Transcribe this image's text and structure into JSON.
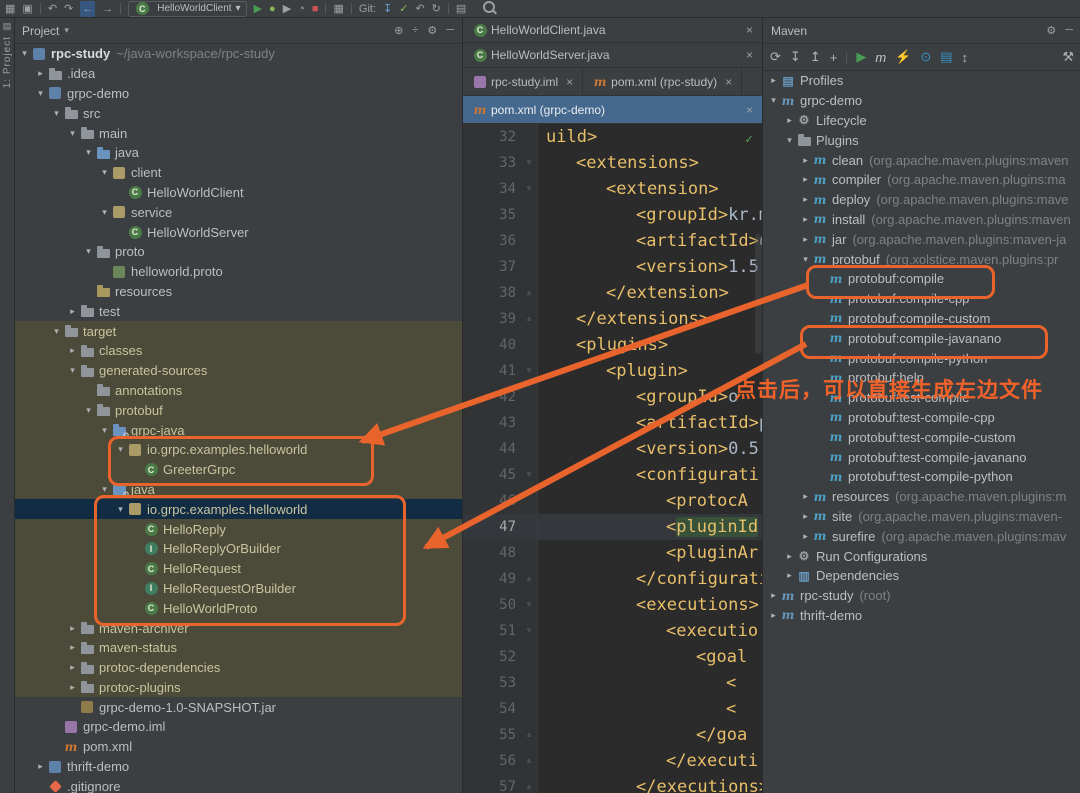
{
  "stripe": {
    "project_label": "1: Project"
  },
  "toolbar": {
    "items": [
      {
        "type": "icon",
        "name": "window-menu-icon",
        "glyph": "▦"
      },
      {
        "type": "icon",
        "name": "open-recent-icon",
        "glyph": "▣"
      },
      {
        "type": "sep"
      },
      {
        "type": "icon",
        "name": "undo-icon",
        "glyph": "↶"
      },
      {
        "type": "icon",
        "name": "redo-icon",
        "glyph": "↷"
      },
      {
        "type": "icon",
        "name": "back-icon",
        "glyph": "←",
        "active": true
      },
      {
        "type": "icon",
        "name": "forward-icon",
        "glyph": "→"
      },
      {
        "type": "sep"
      },
      {
        "type": "dropdown",
        "name": "run-configuration-select",
        "label": "HelloWorldClient"
      },
      {
        "type": "icon",
        "name": "run-icon",
        "glyph": "▶",
        "color": "#499c54"
      },
      {
        "type": "icon",
        "name": "debug-icon",
        "glyph": "●",
        "color": "#89b859"
      },
      {
        "type": "icon",
        "name": "run-coverage-icon",
        "glyph": "▶",
        "color": "#9da0a3"
      },
      {
        "type": "icon",
        "name": "profiler-icon",
        "glyph": "◔",
        "color": "#9da0a3"
      },
      {
        "type": "icon",
        "name": "stop-icon",
        "glyph": "■",
        "color": "#c75450"
      },
      {
        "type": "sep"
      },
      {
        "type": "icon",
        "name": "layout-grid-icon",
        "glyph": "▦",
        "color": "#9da0a3"
      },
      {
        "type": "sep"
      },
      {
        "type": "label",
        "name": "git-label",
        "text": "Git:"
      },
      {
        "type": "icon",
        "name": "git-update-icon",
        "glyph": "↧",
        "color": "#6a9fd8"
      },
      {
        "type": "icon",
        "name": "git-commit-icon",
        "glyph": "✓",
        "color": "#89b859"
      },
      {
        "type": "icon",
        "name": "git-rollback-icon",
        "glyph": "↶",
        "color": "#9da0a3"
      },
      {
        "type": "icon",
        "name": "git-history-icon",
        "glyph": "↻",
        "color": "#9da0a3"
      },
      {
        "type": "sep"
      },
      {
        "type": "icon",
        "name": "diff-icon",
        "glyph": "▤",
        "color": "#9da0a3"
      },
      {
        "type": "search",
        "name": "search-everywhere-icon"
      }
    ]
  },
  "project_panel": {
    "title": "Project",
    "tree": [
      {
        "label": "rpc-study",
        "hint": "~/java-workspace/rpc-study",
        "level": 0,
        "icon": "project-icon",
        "arrow": "open",
        "bold": true
      },
      {
        "label": ".idea",
        "level": 1,
        "icon": "folder-icon",
        "arrow": "closed"
      },
      {
        "label": "grpc-demo",
        "level": 1,
        "icon": "module-icon",
        "arrow": "open"
      },
      {
        "label": "src",
        "level": 2,
        "icon": "folder-icon",
        "arrow": "open"
      },
      {
        "label": "main",
        "level": 3,
        "icon": "folder-icon",
        "arrow": "open"
      },
      {
        "label": "java",
        "level": 4,
        "icon": "src-folder-icon",
        "arrow": "open"
      },
      {
        "label": "client",
        "level": 5,
        "icon": "package-icon",
        "arrow": "open"
      },
      {
        "label": "HelloWorldClient",
        "level": 6,
        "icon": "class-icon"
      },
      {
        "label": "service",
        "level": 5,
        "icon": "package-icon",
        "arrow": "open"
      },
      {
        "label": "HelloWorldServer",
        "level": 6,
        "icon": "class-icon"
      },
      {
        "label": "proto",
        "level": 4,
        "icon": "folder-icon",
        "arrow": "open"
      },
      {
        "label": "helloworld.proto",
        "level": 5,
        "icon": "proto-file-icon"
      },
      {
        "label": "resources",
        "level": 4,
        "icon": "res-folder-icon"
      },
      {
        "label": "test",
        "level": 3,
        "icon": "folder-icon",
        "arrow": "closed"
      },
      {
        "label": "target",
        "level": 2,
        "icon": "folder-icon",
        "arrow": "open",
        "scope": "excluded"
      },
      {
        "label": "classes",
        "level": 3,
        "icon": "folder-icon",
        "arrow": "closed",
        "scope": "excluded"
      },
      {
        "label": "generated-sources",
        "level": 3,
        "icon": "folder-icon",
        "arrow": "open",
        "scope": "excluded"
      },
      {
        "label": "annotations",
        "level": 4,
        "icon": "folder-icon",
        "scope": "excluded"
      },
      {
        "label": "protobuf",
        "level": 4,
        "icon": "folder-icon",
        "arrow": "open",
        "scope": "excluded"
      },
      {
        "label": "grpc-java",
        "level": 5,
        "icon": "gen-folder-icon",
        "arrow": "open",
        "scope": "excluded"
      },
      {
        "label": "io.grpc.examples.helloworld",
        "level": 6,
        "icon": "package-icon",
        "arrow": "open",
        "scope": "excluded"
      },
      {
        "label": "GreeterGrpc",
        "level": 7,
        "icon": "class-icon",
        "scope": "excluded"
      },
      {
        "label": "java",
        "level": 5,
        "icon": "gen-folder-icon",
        "arrow": "open",
        "scope": "excluded"
      },
      {
        "label": "io.grpc.examples.helloworld",
        "level": 6,
        "icon": "package-icon",
        "arrow": "open",
        "selected": true,
        "scope": "excluded"
      },
      {
        "label": "HelloReply",
        "level": 7,
        "icon": "class-icon",
        "scope": "excluded"
      },
      {
        "label": "HelloReplyOrBuilder",
        "level": 7,
        "icon": "interface-icon",
        "scope": "excluded"
      },
      {
        "label": "HelloRequest",
        "level": 7,
        "icon": "class-icon",
        "scope": "excluded"
      },
      {
        "label": "HelloRequestOrBuilder",
        "level": 7,
        "icon": "interface-icon",
        "scope": "excluded"
      },
      {
        "label": "HelloWorldProto",
        "level": 7,
        "icon": "class-icon",
        "scope": "excluded"
      },
      {
        "label": "maven-archiver",
        "level": 3,
        "icon": "folder-icon",
        "arrow": "closed",
        "scope": "excluded"
      },
      {
        "label": "maven-status",
        "level": 3,
        "icon": "folder-icon",
        "arrow": "closed",
        "scope": "excluded"
      },
      {
        "label": "protoc-dependencies",
        "level": 3,
        "icon": "folder-icon",
        "arrow": "closed",
        "scope": "excluded"
      },
      {
        "label": "protoc-plugins",
        "level": 3,
        "icon": "folder-icon",
        "arrow": "closed",
        "scope": "excluded"
      },
      {
        "label": "grpc-demo-1.0-SNAPSHOT.jar",
        "level": 3,
        "icon": "jar-icon"
      },
      {
        "label": "grpc-demo.iml",
        "level": 2,
        "icon": "iml-file-icon"
      },
      {
        "label": "pom.xml",
        "level": 2,
        "icon": "maven-file-icon"
      },
      {
        "label": "thrift-demo",
        "level": 1,
        "icon": "module-icon",
        "arrow": "closed"
      },
      {
        "label": ".gitignore",
        "level": 1,
        "icon": "gitignore-icon"
      }
    ]
  },
  "editor": {
    "tab_rows": [
      [
        {
          "label": "HelloWorldClient.java",
          "icon": "class-icon",
          "close": true
        }
      ],
      [
        {
          "label": "HelloWorldServer.java",
          "icon": "class-icon",
          "close": true
        }
      ],
      [
        {
          "label": "rpc-study.iml",
          "icon": "iml-file-icon",
          "close": true
        },
        {
          "label": "pom.xml (rpc-study)",
          "icon": "maven-file-icon",
          "close": true
        }
      ],
      [
        {
          "label": "pom.xml (grpc-demo)",
          "icon": "maven-file-icon",
          "close": true,
          "active": true
        }
      ]
    ],
    "lines": [
      {
        "num": 32,
        "indent": 0,
        "parts": [
          {
            "t": "uild>",
            "c": "tag"
          }
        ]
      },
      {
        "num": 33,
        "indent": 1,
        "parts": [
          {
            "t": "<extensions>",
            "c": "tag"
          }
        ],
        "fold": "open"
      },
      {
        "num": 34,
        "indent": 2,
        "parts": [
          {
            "t": "<extension>",
            "c": "tag"
          }
        ],
        "fold": "open"
      },
      {
        "num": 35,
        "indent": 3,
        "parts": [
          {
            "t": "<groupId>",
            "c": "tag"
          },
          {
            "t": "kr.m",
            "c": "text"
          }
        ]
      },
      {
        "num": 36,
        "indent": 3,
        "parts": [
          {
            "t": "<artifactId>",
            "c": "tag"
          },
          {
            "t": "o",
            "c": "text"
          }
        ]
      },
      {
        "num": 37,
        "indent": 3,
        "parts": [
          {
            "t": "<version>",
            "c": "tag"
          },
          {
            "t": "1.5.",
            "c": "text"
          }
        ]
      },
      {
        "num": 38,
        "indent": 2,
        "parts": [
          {
            "t": "</extension>",
            "c": "tag"
          }
        ],
        "fold": "close"
      },
      {
        "num": 39,
        "indent": 1,
        "parts": [
          {
            "t": "</extensions>",
            "c": "tag"
          }
        ],
        "fold": "close"
      },
      {
        "num": 40,
        "indent": 1,
        "parts": [
          {
            "t": "<plugins>",
            "c": "tag"
          }
        ]
      },
      {
        "num": 41,
        "indent": 2,
        "parts": [
          {
            "t": "<plugin>",
            "c": "tag"
          }
        ],
        "fold": "open"
      },
      {
        "num": 42,
        "indent": 3,
        "parts": [
          {
            "t": "<groupId>",
            "c": "tag"
          },
          {
            "t": "o",
            "c": "text"
          }
        ]
      },
      {
        "num": 43,
        "indent": 3,
        "parts": [
          {
            "t": "<artifactId>",
            "c": "tag"
          },
          {
            "t": "p",
            "c": "text"
          }
        ]
      },
      {
        "num": 44,
        "indent": 3,
        "parts": [
          {
            "t": "<version>",
            "c": "tag"
          },
          {
            "t": "0.5.",
            "c": "text"
          }
        ]
      },
      {
        "num": 45,
        "indent": 3,
        "parts": [
          {
            "t": "<configurati",
            "c": "tag"
          }
        ],
        "fold": "open"
      },
      {
        "num": 46,
        "indent": 4,
        "parts": [
          {
            "t": "<protocA",
            "c": "tag"
          }
        ]
      },
      {
        "num": 47,
        "indent": 4,
        "parts": [
          {
            "t": "<",
            "c": "tag"
          },
          {
            "t": "pluginId",
            "c": "tag",
            "hl": true
          }
        ],
        "current": true
      },
      {
        "num": 48,
        "indent": 4,
        "parts": [
          {
            "t": "<pluginAr",
            "c": "tag"
          }
        ]
      },
      {
        "num": 49,
        "indent": 3,
        "parts": [
          {
            "t": "</configurati",
            "c": "tag"
          }
        ],
        "fold": "close"
      },
      {
        "num": 50,
        "indent": 3,
        "parts": [
          {
            "t": "<executions>",
            "c": "tag"
          }
        ],
        "fold": "open"
      },
      {
        "num": 51,
        "indent": 4,
        "parts": [
          {
            "t": "<executio",
            "c": "tag"
          }
        ],
        "fold": "open"
      },
      {
        "num": 52,
        "indent": 5,
        "parts": [
          {
            "t": "<goal",
            "c": "tag"
          }
        ]
      },
      {
        "num": 53,
        "indent": 6,
        "parts": [
          {
            "t": "<",
            "c": "tag"
          }
        ]
      },
      {
        "num": 54,
        "indent": 6,
        "parts": [
          {
            "t": "<",
            "c": "tag"
          }
        ]
      },
      {
        "num": 55,
        "indent": 5,
        "parts": [
          {
            "t": "</goa",
            "c": "tag"
          }
        ],
        "fold": "close"
      },
      {
        "num": 56,
        "indent": 4,
        "parts": [
          {
            "t": "</executi",
            "c": "tag"
          }
        ],
        "fold": "close"
      },
      {
        "num": 57,
        "indent": 3,
        "parts": [
          {
            "t": "</executions>",
            "c": "tag"
          }
        ],
        "fold": "close"
      }
    ]
  },
  "maven_panel": {
    "title": "Maven",
    "toolbar_icons": [
      {
        "name": "refresh-icon",
        "glyph": "⟳",
        "color": "#afb1b3"
      },
      {
        "name": "generate-sources-icon",
        "glyph": "↧",
        "color": "#afb1b3"
      },
      {
        "name": "download-sources-icon",
        "glyph": "↥",
        "color": "#afb1b3"
      },
      {
        "name": "add-maven-project-icon",
        "glyph": "+",
        "color": "#afb1b3"
      },
      {
        "name": "sep"
      },
      {
        "name": "run-maven-icon",
        "glyph": "▶",
        "color": "#499c54"
      },
      {
        "name": "execute-goal-icon",
        "glyph": "m",
        "color": "#c5c8ca",
        "italic": true
      },
      {
        "name": "skip-tests-icon",
        "glyph": "⚡",
        "color": "#afb1b3"
      },
      {
        "name": "offline-mode-icon",
        "glyph": "⊙",
        "color": "#3592c4"
      },
      {
        "name": "show-dependencies-icon",
        "glyph": "▤",
        "color": "#3592c4"
      },
      {
        "name": "collapse-all-icon",
        "glyph": "↕",
        "color": "#afb1b3"
      },
      {
        "name": "settings-wrench-icon",
        "glyph": "⚒",
        "color": "#afb1b3",
        "right": true
      }
    ],
    "tree": [
      {
        "label": "Profiles",
        "level": 0,
        "icon": "profiles-icon",
        "arrow": "closed"
      },
      {
        "label": "grpc-demo",
        "level": 0,
        "icon": "maven-project-icon",
        "arrow": "open"
      },
      {
        "label": "Lifecycle",
        "level": 1,
        "icon": "lifecycle-icon",
        "arrow": "closed"
      },
      {
        "label": "Plugins",
        "level": 1,
        "icon": "plugins-icon",
        "arrow": "open"
      },
      {
        "label": "clean",
        "hint": "(org.apache.maven.plugins:maven",
        "level": 2,
        "icon": "maven-plugin-icon",
        "arrow": "closed"
      },
      {
        "label": "compiler",
        "hint": "(org.apache.maven.plugins:ma",
        "level": 2,
        "icon": "maven-plugin-icon",
        "arrow": "closed"
      },
      {
        "label": "deploy",
        "hint": "(org.apache.maven.plugins:mave",
        "level": 2,
        "icon": "maven-plugin-icon",
        "arrow": "closed"
      },
      {
        "label": "install",
        "hint": "(org.apache.maven.plugins:maven",
        "level": 2,
        "icon": "maven-plugin-icon",
        "arrow": "closed"
      },
      {
        "label": "jar",
        "hint": "(org.apache.maven.plugins:maven-ja",
        "level": 2,
        "icon": "maven-plugin-icon",
        "arrow": "closed"
      },
      {
        "label": "protobuf",
        "hint": "(org.xolstice.maven.plugins:pr",
        "level": 2,
        "icon": "maven-plugin-icon",
        "arrow": "open"
      },
      {
        "label": "protobuf:compile",
        "level": 3,
        "icon": "maven-goal-icon"
      },
      {
        "label": "protobuf:compile-cpp",
        "level": 3,
        "icon": "maven-goal-icon"
      },
      {
        "label": "protobuf:compile-custom",
        "level": 3,
        "icon": "maven-goal-icon"
      },
      {
        "label": "protobuf:compile-javanano",
        "level": 3,
        "icon": "maven-goal-icon"
      },
      {
        "label": "protobuf:compile-python",
        "level": 3,
        "icon": "maven-goal-icon"
      },
      {
        "label": "protobuf:help",
        "level": 3,
        "icon": "maven-goal-icon"
      },
      {
        "label": "protobuf:test-compile",
        "level": 3,
        "icon": "maven-goal-icon"
      },
      {
        "label": "protobuf:test-compile-cpp",
        "level": 3,
        "icon": "maven-goal-icon"
      },
      {
        "label": "protobuf:test-compile-custom",
        "level": 3,
        "icon": "maven-goal-icon"
      },
      {
        "label": "protobuf:test-compile-javanano",
        "level": 3,
        "icon": "maven-goal-icon"
      },
      {
        "label": "protobuf:test-compile-python",
        "level": 3,
        "icon": "maven-goal-icon"
      },
      {
        "label": "resources",
        "hint": "(org.apache.maven.plugins:m",
        "level": 2,
        "icon": "maven-plugin-icon",
        "arrow": "closed"
      },
      {
        "label": "site",
        "hint": "(org.apache.maven.plugins:maven-",
        "level": 2,
        "icon": "maven-plugin-icon",
        "arrow": "closed"
      },
      {
        "label": "surefire",
        "hint": "(org.apache.maven.plugins:mav",
        "level": 2,
        "icon": "maven-plugin-icon",
        "arrow": "closed"
      },
      {
        "label": "Run Configurations",
        "level": 1,
        "icon": "run-configs-icon",
        "arrow": "closed"
      },
      {
        "label": "Dependencies",
        "level": 1,
        "icon": "dependencies-icon",
        "arrow": "closed"
      },
      {
        "label": "rpc-study",
        "hint": "(root)",
        "level": 0,
        "icon": "maven-project-icon",
        "arrow": "closed"
      },
      {
        "label": "thrift-demo",
        "level": 0,
        "icon": "maven-project-icon",
        "arrow": "closed"
      }
    ]
  },
  "annotation": {
    "text": "点击后，可以直接生成左边文件",
    "color": "#f2632a"
  }
}
